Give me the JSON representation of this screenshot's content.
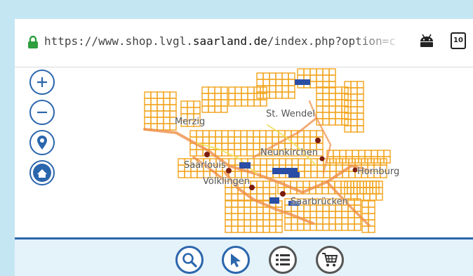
{
  "browser": {
    "url_prefix": "https://www.shop.lvgl.",
    "url_domain": "saarland.de",
    "url_suffix": "/index.php?option=com_virtuem",
    "tab_count": "10"
  },
  "map": {
    "places": {
      "merzig": "Merzig",
      "st_wendel": "St. Wendel",
      "neunkirchen": "Neunkirchen",
      "saarlouis": "Saarlouis",
      "voelklingen": "Völklingen",
      "homburg": "Homburg",
      "saarbruecken": "Saarbrücken"
    }
  },
  "colors": {
    "accent": "#2b66ad",
    "grid": "#f2a31b",
    "road": "#ee8e48",
    "footer_bg": "#e4f2f9",
    "page_bg": "#c4e6f3"
  },
  "icons": {
    "zoom_in": "plus-icon",
    "zoom_out": "minus-icon",
    "locate": "location-pin-icon",
    "home": "home-icon",
    "search": "search-icon",
    "select": "cursor-arrow-icon",
    "list": "list-icon",
    "cart": "cart-icon"
  }
}
